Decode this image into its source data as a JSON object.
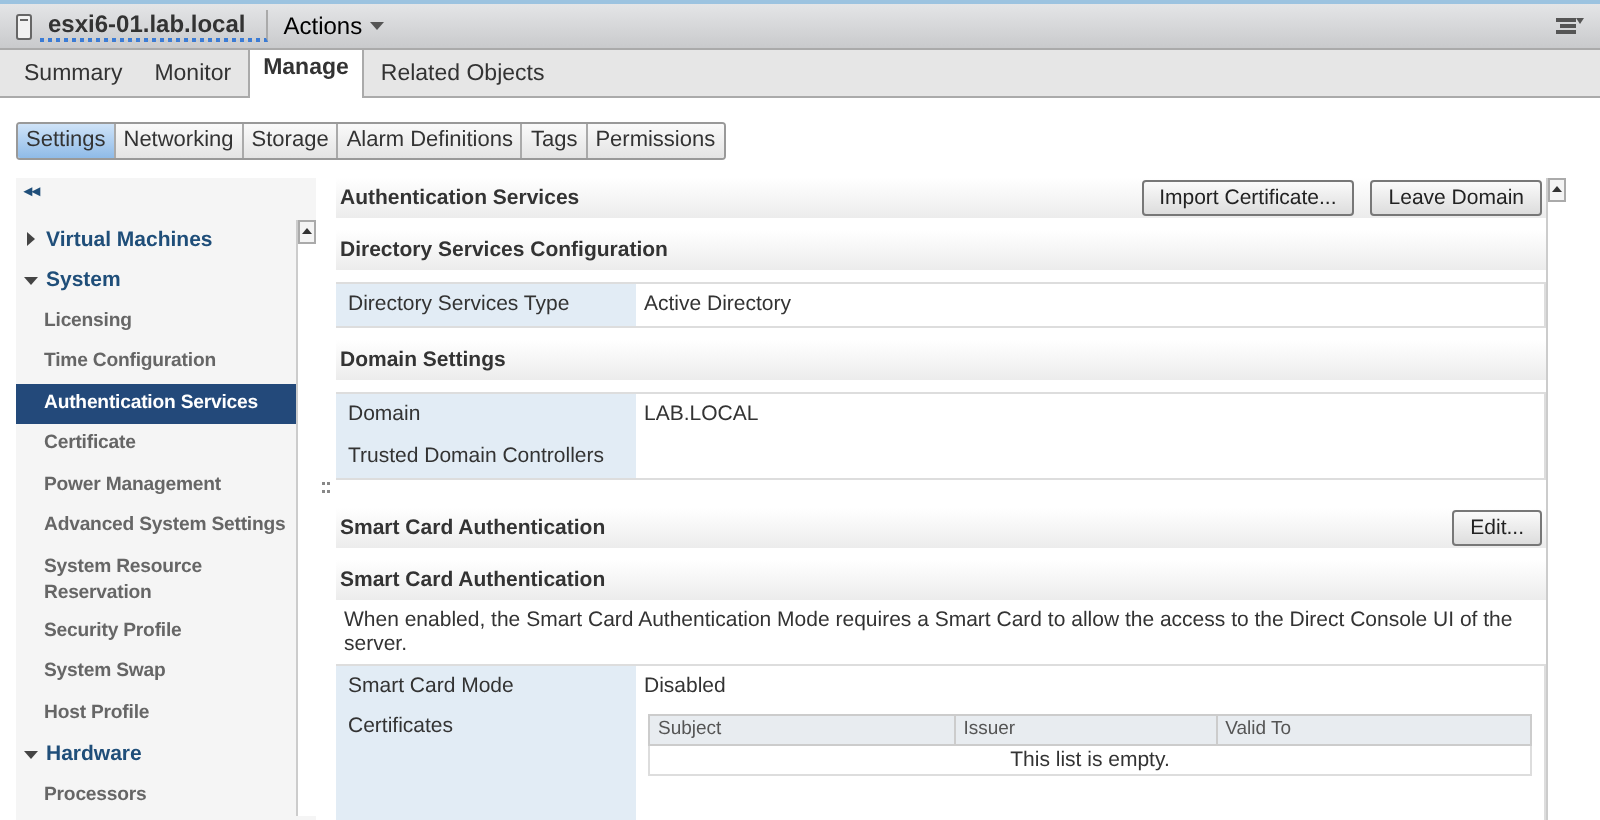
{
  "header": {
    "title": "esxi6-01.lab.local",
    "actions": "Actions"
  },
  "tabs": [
    {
      "label": "Summary",
      "selected": false
    },
    {
      "label": "Monitor",
      "selected": false
    },
    {
      "label": "Manage",
      "selected": true
    },
    {
      "label": "Related Objects",
      "selected": false
    }
  ],
  "subtabs": [
    {
      "label": "Settings",
      "selected": true
    },
    {
      "label": "Networking",
      "selected": false
    },
    {
      "label": "Storage",
      "selected": false
    },
    {
      "label": "Alarm Definitions",
      "selected": false
    },
    {
      "label": "Tags",
      "selected": false
    },
    {
      "label": "Permissions",
      "selected": false
    }
  ],
  "sidebar": {
    "collapse": "◂◂",
    "items": [
      {
        "label": "Virtual Machines",
        "expanded": false,
        "selected": false
      },
      {
        "label": "System",
        "expanded": true,
        "selected": false,
        "children": [
          {
            "label": "Licensing",
            "selected": false
          },
          {
            "label": "Time Configuration",
            "selected": false
          },
          {
            "label": "Authentication Services",
            "selected": true
          },
          {
            "label": "Certificate",
            "selected": false
          },
          {
            "label": "Power Management",
            "selected": false
          },
          {
            "label": "Advanced System Settings",
            "selected": false
          },
          {
            "label": "System Resource Reservation",
            "selected": false
          },
          {
            "label": "Security Profile",
            "selected": false
          },
          {
            "label": "System Swap",
            "selected": false
          },
          {
            "label": "Host Profile",
            "selected": false
          }
        ]
      },
      {
        "label": "Hardware",
        "expanded": true,
        "selected": false,
        "children": [
          {
            "label": "Processors",
            "selected": false
          }
        ]
      }
    ]
  },
  "content": {
    "title": "Authentication Services",
    "buttons": [
      "Import Certificate...",
      "Leave Domain"
    ],
    "sections": [
      {
        "title": "Directory Services Configuration",
        "rows": [
          {
            "label": "Directory Services Type",
            "value": "Active Directory"
          }
        ]
      },
      {
        "title": "Domain Settings",
        "rows": [
          {
            "label": "Domain",
            "value": "LAB.LOCAL"
          },
          {
            "label": "Trusted Domain Controllers"
          }
        ]
      }
    ],
    "smart_card": {
      "title": "Smart Card Authentication",
      "edit": "Edit...",
      "subtitle": "Smart Card Authentication",
      "description": "When enabled, the Smart Card Authentication Mode requires a Smart Card to allow the access to the Direct Console UI of the server.",
      "mode_label": "Smart Card Mode",
      "mode_value": "Disabled",
      "certificates_label": "Certificates",
      "columns": [
        "Subject",
        "Issuer",
        "Valid To"
      ],
      "empty": "This list is empty."
    }
  }
}
